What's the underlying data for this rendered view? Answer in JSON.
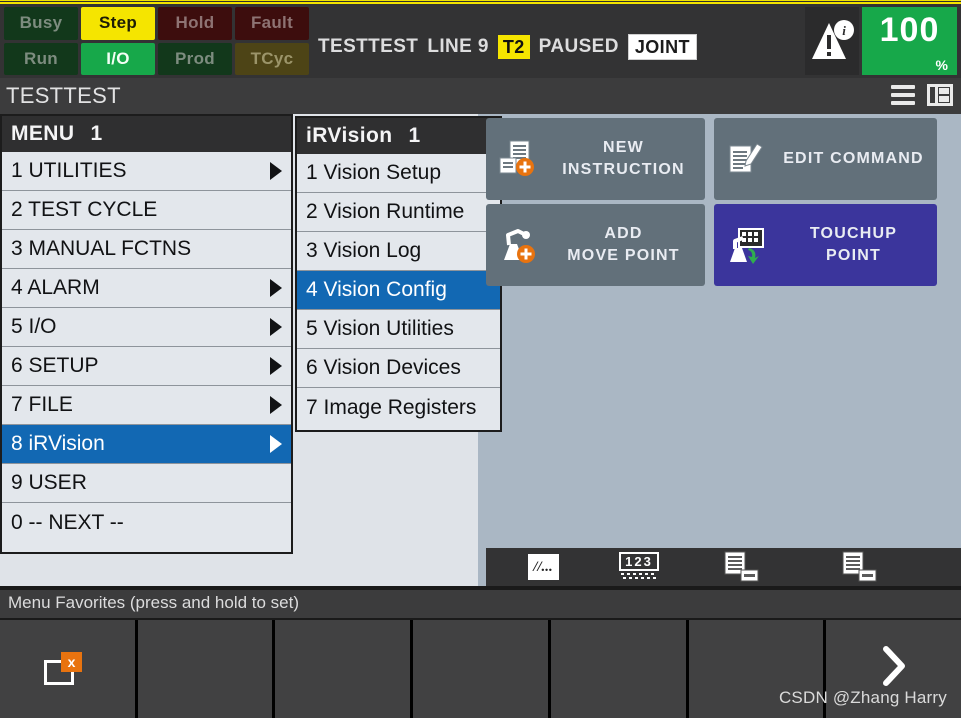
{
  "header": {
    "leds": [
      {
        "label": "Busy",
        "state": "busy"
      },
      {
        "label": "Step",
        "state": "step"
      },
      {
        "label": "Hold",
        "state": "hold"
      },
      {
        "label": "Fault",
        "state": "fault"
      },
      {
        "label": "Run",
        "state": "run"
      },
      {
        "label": "I/O",
        "state": "io"
      },
      {
        "label": "Prod",
        "state": "prod"
      },
      {
        "label": "TCyc",
        "state": "tcyc"
      }
    ],
    "status": {
      "program": "TESTTEST",
      "line_label": "LINE 9",
      "mode": "T2",
      "run_state": "PAUSED",
      "coord": "JOINT"
    },
    "alarm_icon": "warning-info-icon",
    "override": {
      "value": "100",
      "unit": "%"
    }
  },
  "titlebar": {
    "title": "TESTTEST",
    "menu_icon": "hamburger-icon",
    "layout_icon": "screen-layout-icon"
  },
  "menu": {
    "title": "MENU",
    "page": "1",
    "items": [
      {
        "label": "1 UTILITIES",
        "arrow": true,
        "selected": false
      },
      {
        "label": "2 TEST CYCLE",
        "arrow": false,
        "selected": false
      },
      {
        "label": "3 MANUAL FCTNS",
        "arrow": false,
        "selected": false
      },
      {
        "label": "4 ALARM",
        "arrow": true,
        "selected": false
      },
      {
        "label": "5 I/O",
        "arrow": true,
        "selected": false
      },
      {
        "label": "6 SETUP",
        "arrow": true,
        "selected": false
      },
      {
        "label": "7 FILE",
        "arrow": true,
        "selected": false
      },
      {
        "label": "8 iRVision",
        "arrow": true,
        "selected": true
      },
      {
        "label": "9 USER",
        "arrow": false,
        "selected": false
      },
      {
        "label": "0 -- NEXT --",
        "arrow": false,
        "selected": false
      }
    ]
  },
  "submenu": {
    "title": "iRVision",
    "page": "1",
    "items": [
      {
        "label": "1 Vision Setup",
        "selected": false
      },
      {
        "label": "2 Vision Runtime",
        "selected": false
      },
      {
        "label": "3 Vision Log",
        "selected": false
      },
      {
        "label": "4 Vision Config",
        "selected": true
      },
      {
        "label": "5 Vision Utilities",
        "selected": false
      },
      {
        "label": "6 Vision Devices",
        "selected": false
      },
      {
        "label": "7 Image Registers",
        "selected": false
      }
    ]
  },
  "actions": [
    {
      "id": "new-instruction",
      "line1": "NEW",
      "line2": "INSTRUCTION",
      "icon": "new-instruction-icon",
      "style": "gray"
    },
    {
      "id": "edit-command",
      "line1": "EDIT COMMAND",
      "line2": "",
      "icon": "edit-command-icon",
      "style": "gray"
    },
    {
      "id": "add-move-point",
      "line1": "ADD",
      "line2": "MOVE POINT",
      "icon": "add-move-point-icon",
      "style": "gray"
    },
    {
      "id": "touchup-point",
      "line1": "TOUCHUP",
      "line2": "POINT",
      "icon": "touchup-point-icon",
      "style": "purple"
    }
  ],
  "icon_strip": [
    {
      "id": "comment",
      "icon": "comment-slash-icon",
      "text": "//..."
    },
    {
      "id": "numeric",
      "icon": "numeric-keypad-icon",
      "text": "123"
    },
    {
      "id": "insert-line",
      "icon": "insert-line-icon"
    },
    {
      "id": "append-line",
      "icon": "append-line-icon"
    }
  ],
  "favorites": {
    "label": "Menu Favorites (press and hold to set)",
    "cells": [
      {
        "icon": "clear-favorite-icon",
        "x_label": "x"
      },
      {
        "icon": ""
      },
      {
        "icon": ""
      },
      {
        "icon": ""
      },
      {
        "icon": ""
      },
      {
        "icon": ""
      },
      {
        "icon": "chevron-right-icon"
      }
    ]
  },
  "watermark": "CSDN @Zhang Harry",
  "colors": {
    "accent_blue": "#1268b3",
    "accent_green": "#17a84a",
    "accent_yellow": "#f5e500",
    "accent_purple": "#3b359c",
    "accent_orange": "#e8730f"
  }
}
